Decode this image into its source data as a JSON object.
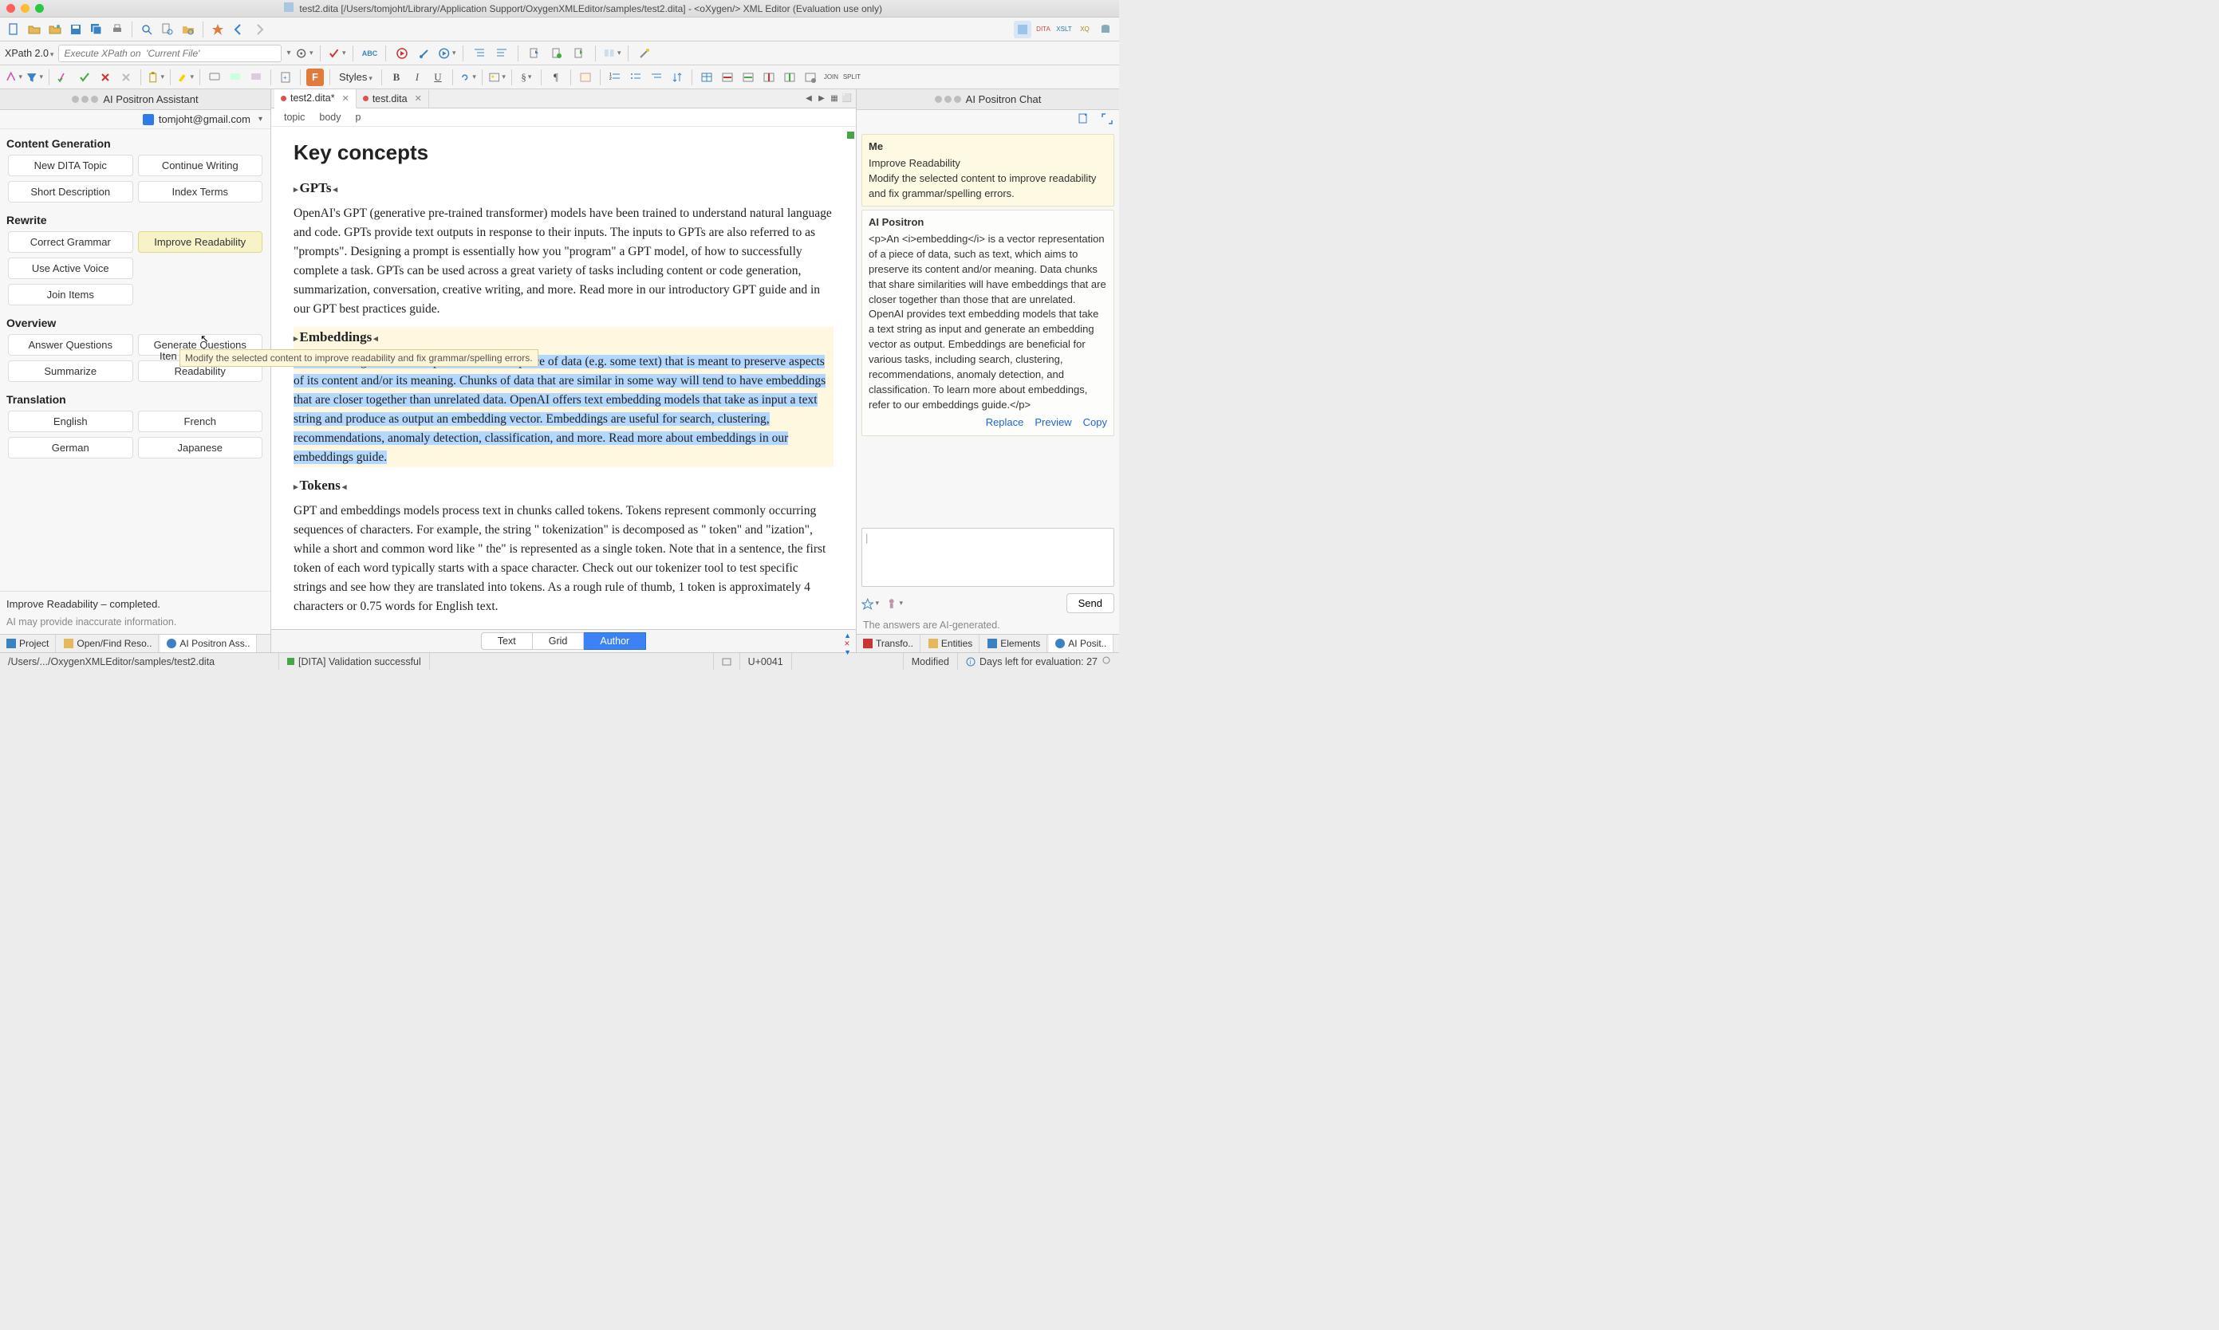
{
  "window": {
    "title": "test2.dita [/Users/tomjoht/Library/Application Support/OxygenXMLEditor/samples/test2.dita] - <oXygen/> XML Editor (Evaluation use only)"
  },
  "xpath": {
    "label": "XPath 2.0",
    "placeholder": "Execute XPath on  'Current File'"
  },
  "toolbar3": {
    "styles": "Styles"
  },
  "leftPanel": {
    "title": "AI Positron Assistant",
    "user": "tomjoht@gmail.com",
    "sections": {
      "contentGen": "Content Generation",
      "rewrite": "Rewrite",
      "overview": "Overview",
      "translation": "Translation"
    },
    "buttons": {
      "newTopic": "New DITA Topic",
      "contWriting": "Continue Writing",
      "shortDesc": "Short Description",
      "indexTerms": "Index Terms",
      "correctGrammar": "Correct Grammar",
      "improveRead": "Improve Readability",
      "activeVoice": "Use Active Voice",
      "joinItems": "Join Items",
      "answerQ": "Answer Questions",
      "genQ": "Generate Questions",
      "summarize": "Summarize",
      "readability": "Readability",
      "english": "English",
      "french": "French",
      "german": "German",
      "japanese": "Japanese"
    },
    "tooltip": "Modify the selected content to improve readability and fix grammar/spelling errors.",
    "status": "Improve Readability – completed.",
    "disclaimer": "AI may provide inaccurate information.",
    "bottomTabs": {
      "project": "Project",
      "openFind": "Open/Find Reso..",
      "assistant": "AI Positron Ass.."
    }
  },
  "editor": {
    "tabs": {
      "t1": "test2.dita*",
      "t2": "test.dita"
    },
    "breadcrumb": {
      "a": "topic",
      "b": "body",
      "c": "p"
    },
    "h1": "Key concepts",
    "h2a": "GPTs",
    "p1": "OpenAI's GPT (generative pre-trained transformer) models have been trained to understand natural language and code. GPTs provide text outputs in response to their inputs. The inputs to GPTs are also referred to as \"prompts\". Designing a prompt is essentially how you \"program\" a GPT model,",
    "p1b": "of how to successfully complete a task. GPTs can be used across a great variety of tasks including content or code generation, summarization, conversation, creative writing, and more. Read more in our introductory GPT guide and in our GPT best practices guide.",
    "h2b": "Embeddings",
    "p2": "An embedding is a vector representation of a piece of data (e.g. some text) that is meant to preserve aspects of its content and/or its meaning. Chunks of data that are similar in some way will tend to have embeddings that are closer together than unrelated data. OpenAI offers text embedding models that take as input a text string and produce as output an embedding vector. Embeddings are useful for search, clustering, recommendations, anomaly detection, classification, and more. Read more about embeddings in our embeddings guide.",
    "h2c": "Tokens",
    "p3": "GPT and embeddings models process text in chunks called tokens. Tokens represent commonly occurring sequences of characters. For example, the string \" tokenization\" is decomposed as \" token\" and \"ization\", while a short and common word like \" the\" is represented as a single token. Note that in a sentence, the first token of each word typically starts with a space character. Check out our tokenizer tool to test specific strings and see how they are translated into tokens. As a rough rule of thumb, 1 token is approximately 4 characters or 0.75 words for English text.",
    "views": {
      "text": "Text",
      "grid": "Grid",
      "author": "Author"
    }
  },
  "rightPanel": {
    "title": "AI Positron Chat",
    "me": {
      "who": "Me",
      "line1": "Improve Readability",
      "line2": "Modify the selected content to improve readability and fix grammar/spelling errors."
    },
    "ai": {
      "who": "AI Positron",
      "body": "<p>An <i>embedding</i> is a vector representation of a piece of data, such as text, which aims to preserve its content and/or meaning. Data chunks that share similarities will have embeddings that are closer together than those that are unrelated. OpenAI provides text embedding models that take a text string as input and generate an embedding vector as output. Embeddings are beneficial for various tasks, including search, clustering, recommendations, anomaly detection, and classification. To learn more about embeddings, refer to our embeddings guide.</p>"
    },
    "actions": {
      "replace": "Replace",
      "preview": "Preview",
      "copy": "Copy"
    },
    "send": "Send",
    "disclaimer": "The answers are AI-generated.",
    "bottomTabs": {
      "transfo": "Transfo..",
      "entities": "Entities",
      "elements": "Elements",
      "chat": "AI Posit.."
    }
  },
  "statusbar": {
    "path": "/Users/.../OxygenXMLEditor/samples/test2.dita",
    "validation": "[DITA] Validation successful",
    "unicode": "U+0041",
    "modified": "Modified",
    "trial": "Days left for evaluation: 27"
  }
}
